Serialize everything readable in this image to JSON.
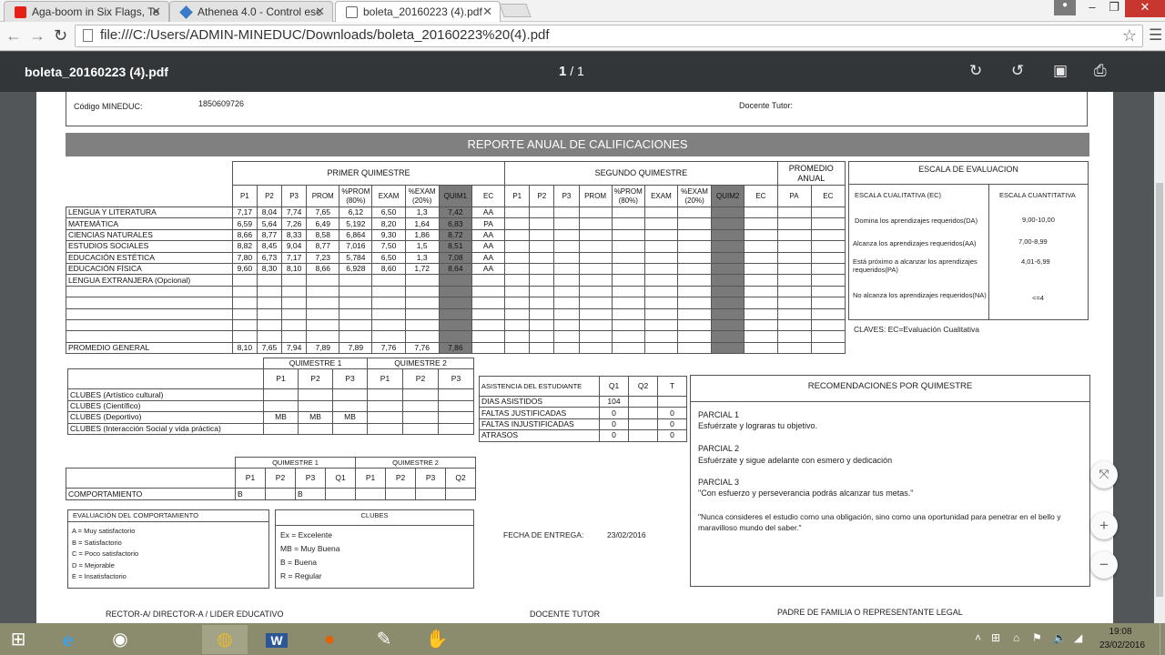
{
  "browser": {
    "tabs": [
      {
        "title": "Aga-boom in Six Flags, Te",
        "icon": "youtube-icon"
      },
      {
        "title": "Athenea 4.0 - Control esc",
        "icon": "athenea-icon"
      },
      {
        "title": "boleta_20160223 (4).pdf",
        "icon": "document-icon"
      }
    ],
    "address": "file:///C:/Users/ADMIN-MINEDUC/Downloads/boleta_20160223%20(4).pdf"
  },
  "pdf": {
    "filename": "boleta_20160223 (4).pdf",
    "page_current": "1",
    "page_sep": "/",
    "page_total": "1"
  },
  "doc": {
    "codigo_label": "Código MINEDUC:",
    "codigo_value": "1850609726",
    "docente_label": "Docente Tutor:",
    "report_title": "REPORTE ANUAL DE CALIFICACIONES",
    "grades": {
      "q1_label": "PRIMER QUIMESTRE",
      "q2_label": "SEGUNDO QUIMESTRE",
      "prom_anual": "PROMEDIO ANUAL",
      "cols_q1": [
        "P1",
        "P2",
        "P3",
        "PROM",
        "%PROM (80%)",
        "EXAM",
        "%EXAM (20%)",
        "QUIM1",
        "EC"
      ],
      "cols_q2": [
        "P1",
        "P2",
        "P3",
        "PROM",
        "%PROM (80%)",
        "EXAM",
        "%EXAM (20%)",
        "QUIM2",
        "EC"
      ],
      "cols_anual": [
        "PA",
        "EC"
      ],
      "rows": [
        {
          "subject": "LENGUA Y LITERATURA",
          "v": [
            "7,17",
            "8,04",
            "7,74",
            "7,65",
            "6,12",
            "6,50",
            "1,3",
            "7,42",
            "AA"
          ]
        },
        {
          "subject": "MATEMÁTICA",
          "v": [
            "6,59",
            "5,64",
            "7,26",
            "6,49",
            "5,192",
            "8,20",
            "1,64",
            "6,83",
            "PA"
          ]
        },
        {
          "subject": "CIENCIAS NATURALES",
          "v": [
            "8,66",
            "8,77",
            "8,33",
            "8,58",
            "6,864",
            "9,30",
            "1,86",
            "8,72",
            "AA"
          ]
        },
        {
          "subject": "ESTUDIOS SOCIALES",
          "v": [
            "8,82",
            "8,45",
            "9,04",
            "8,77",
            "7,016",
            "7,50",
            "1,5",
            "8,51",
            "AA"
          ]
        },
        {
          "subject": "EDUCACIÓN ESTÉTICA",
          "v": [
            "7,80",
            "6,73",
            "7,17",
            "7,23",
            "5,784",
            "6,50",
            "1,3",
            "7,08",
            "AA"
          ]
        },
        {
          "subject": "EDUCACIÓN FÍSICA",
          "v": [
            "9,60",
            "8,30",
            "8,10",
            "8,66",
            "6,928",
            "8,60",
            "1,72",
            "8,64",
            "AA"
          ]
        },
        {
          "subject": "LENGUA EXTRANJERA (Opcional)",
          "v": [
            "",
            "",
            "",
            "",
            "",
            "",
            "",
            "",
            ""
          ]
        }
      ],
      "promedio_label": "PROMEDIO GENERAL",
      "promedio": [
        "8,10",
        "7,65",
        "7,94",
        "7,89",
        "7,89",
        "7,76",
        "7,76",
        "7,86"
      ]
    },
    "escala": {
      "title": "ESCALA DE EVALUACION",
      "col1": "ESCALA CUALITATIVA (EC)",
      "col2": "ESCALA CUANTITATIVA",
      "rows": [
        {
          "q": "Domina los aprendizajes requeridos(DA)",
          "n": "9,00-10,00"
        },
        {
          "q": "Alcanza los aprendizajes requeridos(AA)",
          "n": "7,00-8,99"
        },
        {
          "q": "Está próximo a alcanzar los aprendizajes requeridos(PA)",
          "n": "4,01-6,99"
        },
        {
          "q": "No alcanza los aprendizajes requeridos(NA)",
          "n": "<=4"
        }
      ],
      "claves": "CLAVES: EC=Evaluación Cualitativa"
    },
    "clubes": {
      "q1": "QUIMESTRE 1",
      "q2": "QUIMESTRE 2",
      "cols": [
        "P1",
        "P2",
        "P3",
        "P1",
        "P2",
        "P3"
      ],
      "rows": [
        {
          "name": "CLUBES (Artístico cultural)",
          "v": [
            "",
            "",
            "",
            "",
            "",
            ""
          ]
        },
        {
          "name": "CLUBES (Científico)",
          "v": [
            "",
            "",
            "",
            "",
            "",
            ""
          ]
        },
        {
          "name": "CLUBES (Deportivo)",
          "v": [
            "MB",
            "MB",
            "MB",
            "",
            "",
            ""
          ]
        },
        {
          "name": "CLUBES (Interacción Social y vida práctica)",
          "v": [
            "",
            "",
            "",
            "",
            "",
            ""
          ]
        }
      ]
    },
    "asistencia": {
      "title": "ASISTENCIA DEL ESTUDIANTE",
      "cols": [
        "Q1",
        "Q2",
        "T"
      ],
      "rows": [
        {
          "name": "DIAS ASISTIDOS",
          "v": [
            "104",
            "",
            ""
          ]
        },
        {
          "name": "FALTAS JUSTIFICADAS",
          "v": [
            "0",
            "",
            "0"
          ]
        },
        {
          "name": "FALTAS INJUSTIFICADAS",
          "v": [
            "0",
            "",
            "0"
          ]
        },
        {
          "name": "ATRASOS",
          "v": [
            "0",
            "",
            "0"
          ]
        }
      ]
    },
    "comportamiento": {
      "q1": "QUIMESTRE 1",
      "q2": "QUIMESTRE 2",
      "cols": [
        "P1",
        "P2",
        "P3",
        "Q1",
        "P1",
        "P2",
        "P3",
        "Q2"
      ],
      "label": "COMPORTAMIENTO",
      "v": [
        "B",
        "",
        "B",
        "",
        "",
        "",
        "",
        ""
      ]
    },
    "eval_comp": {
      "title": "EVALUACIÓN DEL COMPORTAMIENTO",
      "items": [
        "A = Muy satisfactorio",
        "B = Satisfactorio",
        "C = Poco satisfactorio",
        "D = Mejorable",
        "E = Insatisfactorio"
      ]
    },
    "clubes_key": {
      "title": "CLUBES",
      "items": [
        "Ex = Excelente",
        "MB = Muy Buena",
        "B = Buena",
        "R = Regular"
      ]
    },
    "fecha_label": "FECHA DE ENTREGA:",
    "fecha_value": "23/02/2016",
    "recomendaciones": {
      "title": "RECOMENDACIONES POR QUIMESTRE",
      "p1_title": "PARCIAL 1",
      "p1_text": "Esfuérzate y lograras tu objetivo.",
      "p2_title": "PARCIAL 2",
      "p2_text": "Esfuérzate y sigue adelante con esmero y dedicación",
      "p3_title": "PARCIAL 3",
      "p3_text": "\"Con esfuerzo y perseverancia podrás alcanzar tus metas.\"",
      "quote": "\"Nunca consideres el estudio como una obligación, sino como una oportunidad para penetrar en el bello y maravilloso mundo del saber.\""
    },
    "firmas": {
      "rector": "RECTOR-A/ DIRECTOR-A / LIDER EDUCATIVO",
      "docente": "DOCENTE TUTOR",
      "padre": "PADRE DE FAMILIA O REPRESENTANTE LEGAL"
    }
  },
  "taskbar": {
    "time": "19:08",
    "date": "23/02/2016"
  }
}
